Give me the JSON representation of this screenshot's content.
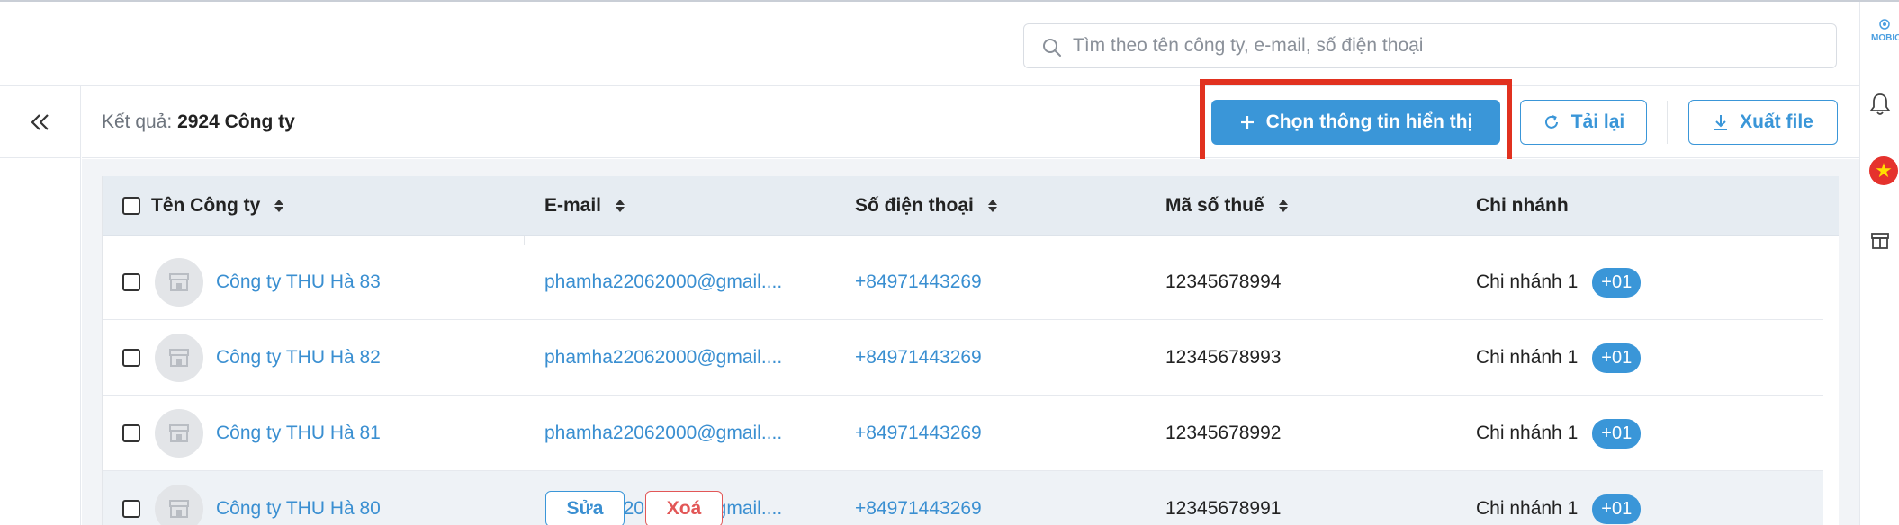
{
  "search": {
    "placeholder": "Tìm theo tên công ty, e-mail, số điện thoại"
  },
  "right_rail": {
    "logo_text": "MOBIO",
    "flag_glyph": "★",
    "icons": [
      "mobio-logo-icon",
      "bell-icon",
      "vietnam-flag-icon",
      "store-icon"
    ]
  },
  "toolbar": {
    "result_label": "Kết quả:",
    "result_value": "2924 Công ty",
    "choose_info_label": "Chọn thông tin hiển thị",
    "reload_label": "Tải lại",
    "export_label": "Xuất file"
  },
  "table": {
    "headers": [
      "Tên Công ty",
      "E-mail",
      "Số điện thoại",
      "Mã số thuế",
      "Chi nhánh"
    ],
    "rows": [
      {
        "name": "Công ty THU Hà 83",
        "email": "phamha22062000@gmail....",
        "phone": "+84971443269",
        "tax": "12345678994",
        "branch": "Chi nhánh 1",
        "badge": "+01"
      },
      {
        "name": "Công ty THU Hà 82",
        "email": "phamha22062000@gmail....",
        "phone": "+84971443269",
        "tax": "12345678993",
        "branch": "Chi nhánh 1",
        "badge": "+01"
      },
      {
        "name": "Công ty THU Hà 81",
        "email": "phamha22062000@gmail....",
        "phone": "+84971443269",
        "tax": "12345678992",
        "branch": "Chi nhánh 1",
        "badge": "+01"
      },
      {
        "name": "Công ty THU Hà 80",
        "email": "phamha22062000@gmail....",
        "phone": "+84971443269",
        "tax": "12345678991",
        "branch": "Chi nhánh 1",
        "badge": "+01"
      }
    ],
    "row_actions": {
      "edit_label": "Sửa",
      "delete_label": "Xoá"
    }
  },
  "colors": {
    "primary": "#3a96d8",
    "highlight": "#e1311f",
    "danger": "#e25757",
    "header_bg": "#e6ecf2"
  }
}
